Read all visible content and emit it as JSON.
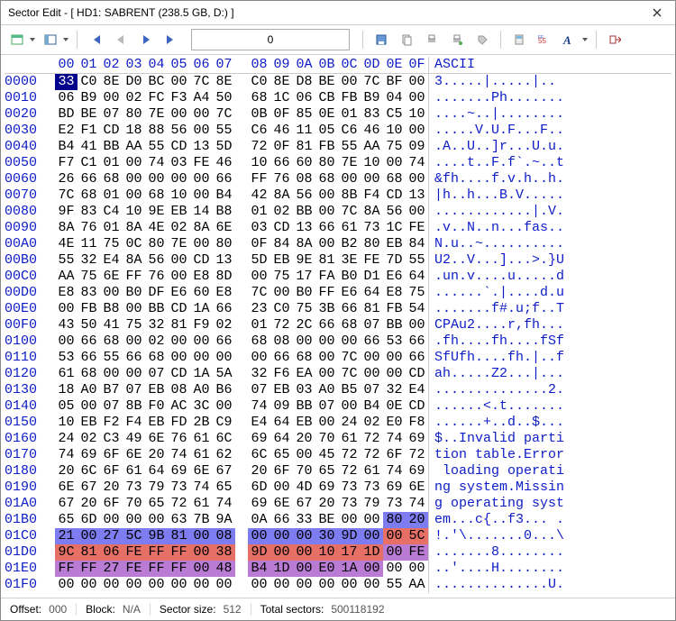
{
  "title": "Sector Edit - [ HD1: SABRENT (238.5 GB, D:) ]",
  "toolbar": {
    "sector_input": "0"
  },
  "status": {
    "offset_label": "Offset:",
    "offset_value": "000",
    "block_label": "Block:",
    "block_value": "N/A",
    "secsize_label": "Sector size:",
    "secsize_value": "512",
    "total_label": "Total sectors:",
    "total_value": "500118192"
  },
  "header": {
    "cols": [
      "00",
      "01",
      "02",
      "03",
      "04",
      "05",
      "06",
      "07",
      "08",
      "09",
      "0A",
      "0B",
      "0C",
      "0D",
      "0E",
      "0F"
    ],
    "ascii": "ASCII"
  },
  "rows": [
    {
      "o": "0000",
      "b": [
        "33",
        "C0",
        "8E",
        "D0",
        "BC",
        "00",
        "7C",
        "8E",
        "C0",
        "8E",
        "D8",
        "BE",
        "00",
        "7C",
        "BF",
        "00"
      ],
      "a": "3.....|.....|.."
    },
    {
      "o": "0010",
      "b": [
        "06",
        "B9",
        "00",
        "02",
        "FC",
        "F3",
        "A4",
        "50",
        "68",
        "1C",
        "06",
        "CB",
        "FB",
        "B9",
        "04",
        "00"
      ],
      "a": ".......Ph......."
    },
    {
      "o": "0020",
      "b": [
        "BD",
        "BE",
        "07",
        "80",
        "7E",
        "00",
        "00",
        "7C",
        "0B",
        "0F",
        "85",
        "0E",
        "01",
        "83",
        "C5",
        "10"
      ],
      "a": "....~..|........"
    },
    {
      "o": "0030",
      "b": [
        "E2",
        "F1",
        "CD",
        "18",
        "88",
        "56",
        "00",
        "55",
        "C6",
        "46",
        "11",
        "05",
        "C6",
        "46",
        "10",
        "00"
      ],
      "a": ".....V.U.F...F.."
    },
    {
      "o": "0040",
      "b": [
        "B4",
        "41",
        "BB",
        "AA",
        "55",
        "CD",
        "13",
        "5D",
        "72",
        "0F",
        "81",
        "FB",
        "55",
        "AA",
        "75",
        "09"
      ],
      "a": ".A..U..]r...U.u."
    },
    {
      "o": "0050",
      "b": [
        "F7",
        "C1",
        "01",
        "00",
        "74",
        "03",
        "FE",
        "46",
        "10",
        "66",
        "60",
        "80",
        "7E",
        "10",
        "00",
        "74"
      ],
      "a": "....t..F.f`.~..t"
    },
    {
      "o": "0060",
      "b": [
        "26",
        "66",
        "68",
        "00",
        "00",
        "00",
        "00",
        "66",
        "FF",
        "76",
        "08",
        "68",
        "00",
        "00",
        "68",
        "00"
      ],
      "a": "&fh....f.v.h..h."
    },
    {
      "o": "0070",
      "b": [
        "7C",
        "68",
        "01",
        "00",
        "68",
        "10",
        "00",
        "B4",
        "42",
        "8A",
        "56",
        "00",
        "8B",
        "F4",
        "CD",
        "13"
      ],
      "a": "|h..h...B.V....."
    },
    {
      "o": "0080",
      "b": [
        "9F",
        "83",
        "C4",
        "10",
        "9E",
        "EB",
        "14",
        "B8",
        "01",
        "02",
        "BB",
        "00",
        "7C",
        "8A",
        "56",
        "00"
      ],
      "a": "............|.V."
    },
    {
      "o": "0090",
      "b": [
        "8A",
        "76",
        "01",
        "8A",
        "4E",
        "02",
        "8A",
        "6E",
        "03",
        "CD",
        "13",
        "66",
        "61",
        "73",
        "1C",
        "FE"
      ],
      "a": ".v..N..n...fas.."
    },
    {
      "o": "00A0",
      "b": [
        "4E",
        "11",
        "75",
        "0C",
        "80",
        "7E",
        "00",
        "80",
        "0F",
        "84",
        "8A",
        "00",
        "B2",
        "80",
        "EB",
        "84"
      ],
      "a": "N.u..~.........."
    },
    {
      "o": "00B0",
      "b": [
        "55",
        "32",
        "E4",
        "8A",
        "56",
        "00",
        "CD",
        "13",
        "5D",
        "EB",
        "9E",
        "81",
        "3E",
        "FE",
        "7D",
        "55"
      ],
      "a": "U2..V...]...>.}U"
    },
    {
      "o": "00C0",
      "b": [
        "AA",
        "75",
        "6E",
        "FF",
        "76",
        "00",
        "E8",
        "8D",
        "00",
        "75",
        "17",
        "FA",
        "B0",
        "D1",
        "E6",
        "64"
      ],
      "a": ".un.v....u.....d"
    },
    {
      "o": "00D0",
      "b": [
        "E8",
        "83",
        "00",
        "B0",
        "DF",
        "E6",
        "60",
        "E8",
        "7C",
        "00",
        "B0",
        "FF",
        "E6",
        "64",
        "E8",
        "75"
      ],
      "a": "......`.|....d.u"
    },
    {
      "o": "00E0",
      "b": [
        "00",
        "FB",
        "B8",
        "00",
        "BB",
        "CD",
        "1A",
        "66",
        "23",
        "C0",
        "75",
        "3B",
        "66",
        "81",
        "FB",
        "54"
      ],
      "a": ".......f#.u;f..T"
    },
    {
      "o": "00F0",
      "b": [
        "43",
        "50",
        "41",
        "75",
        "32",
        "81",
        "F9",
        "02",
        "01",
        "72",
        "2C",
        "66",
        "68",
        "07",
        "BB",
        "00"
      ],
      "a": "CPAu2....r,fh..."
    },
    {
      "o": "0100",
      "b": [
        "00",
        "66",
        "68",
        "00",
        "02",
        "00",
        "00",
        "66",
        "68",
        "08",
        "00",
        "00",
        "00",
        "66",
        "53",
        "66"
      ],
      "a": ".fh....fh....fSf"
    },
    {
      "o": "0110",
      "b": [
        "53",
        "66",
        "55",
        "66",
        "68",
        "00",
        "00",
        "00",
        "00",
        "66",
        "68",
        "00",
        "7C",
        "00",
        "00",
        "66"
      ],
      "a": "SfUfh....fh.|..f"
    },
    {
      "o": "0120",
      "b": [
        "61",
        "68",
        "00",
        "00",
        "07",
        "CD",
        "1A",
        "5A",
        "32",
        "F6",
        "EA",
        "00",
        "7C",
        "00",
        "00",
        "CD"
      ],
      "a": "ah.....Z2...|..."
    },
    {
      "o": "0130",
      "b": [
        "18",
        "A0",
        "B7",
        "07",
        "EB",
        "08",
        "A0",
        "B6",
        "07",
        "EB",
        "03",
        "A0",
        "B5",
        "07",
        "32",
        "E4"
      ],
      "a": "..............2."
    },
    {
      "o": "0140",
      "b": [
        "05",
        "00",
        "07",
        "8B",
        "F0",
        "AC",
        "3C",
        "00",
        "74",
        "09",
        "BB",
        "07",
        "00",
        "B4",
        "0E",
        "CD"
      ],
      "a": "......<.t......."
    },
    {
      "o": "0150",
      "b": [
        "10",
        "EB",
        "F2",
        "F4",
        "EB",
        "FD",
        "2B",
        "C9",
        "E4",
        "64",
        "EB",
        "00",
        "24",
        "02",
        "E0",
        "F8"
      ],
      "a": "......+..d..$..."
    },
    {
      "o": "0160",
      "b": [
        "24",
        "02",
        "C3",
        "49",
        "6E",
        "76",
        "61",
        "6C",
        "69",
        "64",
        "20",
        "70",
        "61",
        "72",
        "74",
        "69"
      ],
      "a": "$..Invalid parti"
    },
    {
      "o": "0170",
      "b": [
        "74",
        "69",
        "6F",
        "6E",
        "20",
        "74",
        "61",
        "62",
        "6C",
        "65",
        "00",
        "45",
        "72",
        "72",
        "6F",
        "72"
      ],
      "a": "tion table.Error"
    },
    {
      "o": "0180",
      "b": [
        "20",
        "6C",
        "6F",
        "61",
        "64",
        "69",
        "6E",
        "67",
        "20",
        "6F",
        "70",
        "65",
        "72",
        "61",
        "74",
        "69"
      ],
      "a": " loading operati"
    },
    {
      "o": "0190",
      "b": [
        "6E",
        "67",
        "20",
        "73",
        "79",
        "73",
        "74",
        "65",
        "6D",
        "00",
        "4D",
        "69",
        "73",
        "73",
        "69",
        "6E"
      ],
      "a": "ng system.Missin"
    },
    {
      "o": "01A0",
      "b": [
        "67",
        "20",
        "6F",
        "70",
        "65",
        "72",
        "61",
        "74",
        "69",
        "6E",
        "67",
        "20",
        "73",
        "79",
        "73",
        "74"
      ],
      "a": "g operating syst"
    },
    {
      "o": "01B0",
      "b": [
        "65",
        "6D",
        "00",
        "00",
        "00",
        "63",
        "7B",
        "9A",
        "0A",
        "66",
        "33",
        "BE",
        "00",
        "00",
        "80",
        "20"
      ],
      "a": "em...c{..f3... ."
    },
    {
      "o": "01C0",
      "b": [
        "21",
        "00",
        "27",
        "5C",
        "9B",
        "81",
        "00",
        "08",
        "00",
        "00",
        "00",
        "30",
        "9D",
        "00",
        "00",
        "5C"
      ],
      "a": "!.'\\.......0...\\"
    },
    {
      "o": "01D0",
      "b": [
        "9C",
        "81",
        "06",
        "FE",
        "FF",
        "FF",
        "00",
        "38",
        "9D",
        "00",
        "00",
        "10",
        "17",
        "1D",
        "00",
        "FE"
      ],
      "a": ".......8........"
    },
    {
      "o": "01E0",
      "b": [
        "FF",
        "FF",
        "27",
        "FE",
        "FF",
        "FF",
        "00",
        "48",
        "B4",
        "1D",
        "00",
        "E0",
        "1A",
        "00",
        "00",
        "00"
      ],
      "a": "..'....H........"
    },
    {
      "o": "01F0",
      "b": [
        "00",
        "00",
        "00",
        "00",
        "00",
        "00",
        "00",
        "00",
        "00",
        "00",
        "00",
        "00",
        "00",
        "00",
        "55",
        "AA"
      ],
      "a": "..............U."
    }
  ],
  "highlight": {
    "01B0": {
      "14": "hl-b2",
      "15": "hl-b2"
    },
    "01C0": {
      "all": "hl-blue",
      "14": "hl-red",
      "15": "hl-red"
    },
    "01D0": {
      "all": "hl-red",
      "14": "hl-pur",
      "15": "hl-pur"
    },
    "01E0": {
      "all": "hl-pur",
      "14": "",
      "15": ""
    }
  }
}
